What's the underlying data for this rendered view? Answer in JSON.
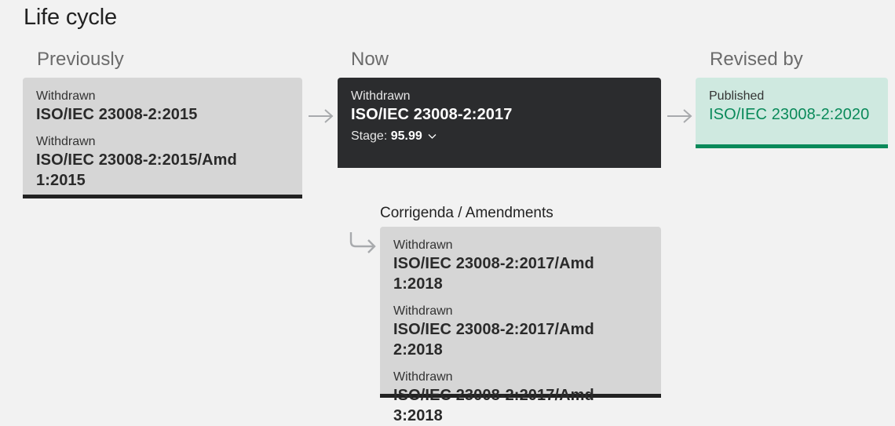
{
  "page": {
    "title": "Life cycle"
  },
  "columns": {
    "previously": {
      "heading": "Previously",
      "items": [
        {
          "status": "Withdrawn",
          "reference": "ISO/IEC 23008-2:2015"
        },
        {
          "status": "Withdrawn",
          "reference": "ISO/IEC 23008-2:2015/Amd 1:2015"
        }
      ]
    },
    "now": {
      "heading": "Now",
      "status": "Withdrawn",
      "reference": "ISO/IEC 23008-2:2017",
      "stage_label": "Stage:",
      "stage_value": "95.99"
    },
    "revised_by": {
      "heading": "Revised by",
      "status": "Published",
      "reference": "ISO/IEC 23008-2:2020"
    }
  },
  "amendments": {
    "heading": "Corrigenda / Amendments",
    "items": [
      {
        "status": "Withdrawn",
        "reference": "ISO/IEC 23008-2:2017/Amd 1:2018"
      },
      {
        "status": "Withdrawn",
        "reference": "ISO/IEC 23008-2:2017/Amd 2:2018"
      },
      {
        "status": "Withdrawn",
        "reference": "ISO/IEC 23008-2:2017/Amd 3:2018"
      }
    ]
  },
  "icons": {
    "flow_arrow": "arrow-right-icon",
    "branch_arrow": "return-arrow-icon",
    "stage_toggle": "chevron-down-icon"
  },
  "colors": {
    "background": "#f2f2f2",
    "card_grey": "#d6d6d6",
    "card_dark": "#2b2c2e",
    "card_green": "#cfe9e0",
    "accent_green": "#0a8a5a",
    "border_dark": "#222222",
    "heading_grey": "#6b6b6b"
  }
}
